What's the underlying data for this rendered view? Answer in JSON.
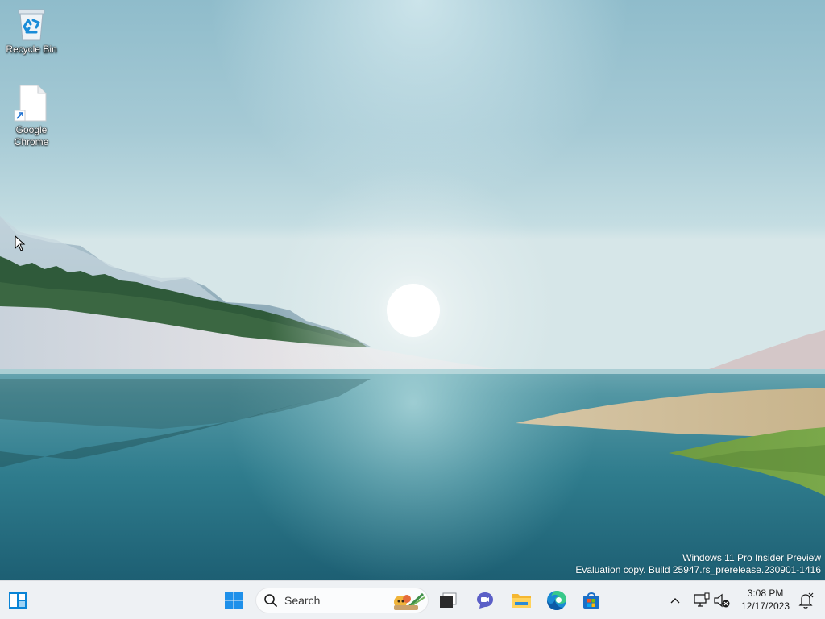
{
  "desktop": {
    "icons": [
      {
        "label": "Recycle Bin",
        "icon": "recycle-bin-icon"
      },
      {
        "label": "Google Chrome",
        "icon": "shortcut-file-icon"
      }
    ],
    "watermark": {
      "line1": "Windows 11 Pro Insider Preview",
      "line2": "Evaluation copy. Build 25947.rs_prerelease.230901-1416"
    }
  },
  "taskbar": {
    "search_placeholder": "Search",
    "pinned": [
      "widgets",
      "start",
      "task-view",
      "chat",
      "file-explorer",
      "edge",
      "microsoft-store"
    ],
    "clock": {
      "time": "3:08 PM",
      "date": "12/17/2023"
    }
  },
  "colors": {
    "taskbar_bg": "#eef1f4",
    "accent_blue": "#0078d4"
  }
}
